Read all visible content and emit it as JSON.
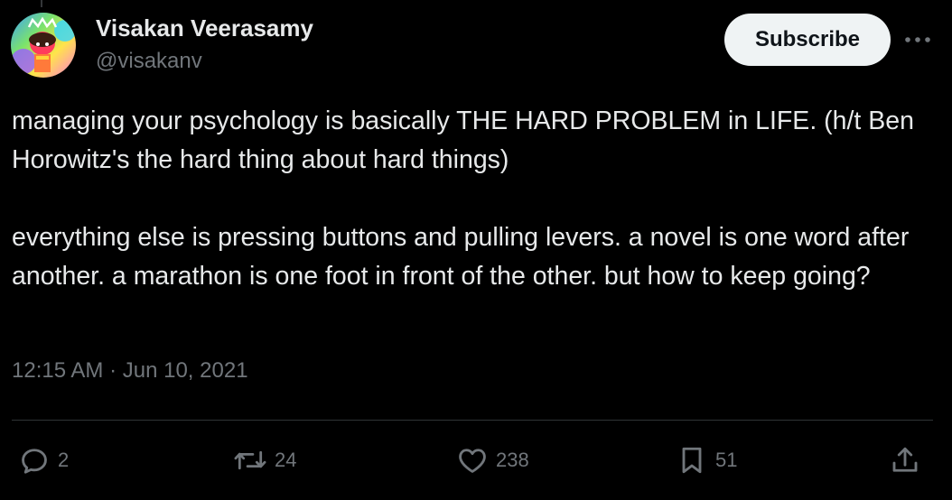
{
  "author": {
    "name": "Visakan Veerasamy",
    "handle": "@visakanv"
  },
  "header": {
    "subscribe_label": "Subscribe",
    "more_icon": "more-horizontal-icon"
  },
  "tweet": {
    "text": "managing your psychology is basically THE HARD PROBLEM in LIFE. (h/t Ben Horowitz's the hard thing about hard things)\n\neverything else is pressing buttons and pulling levers. a novel is one word after another. a marathon is one foot in front of the other. but how to keep going?",
    "time": "12:15 AM",
    "separator": "·",
    "date": "Jun 10, 2021"
  },
  "actions": {
    "reply": {
      "icon": "reply-icon",
      "count": "2"
    },
    "retweet": {
      "icon": "retweet-icon",
      "count": "24"
    },
    "like": {
      "icon": "like-icon",
      "count": "238"
    },
    "bookmark": {
      "icon": "bookmark-icon",
      "count": "51"
    },
    "share": {
      "icon": "share-icon"
    }
  },
  "colors": {
    "background": "#000000",
    "text_primary": "#e7e9ea",
    "text_secondary": "#71767b",
    "divider": "#2f3336",
    "button_bg": "#eff3f4",
    "button_text": "#0f1419"
  }
}
